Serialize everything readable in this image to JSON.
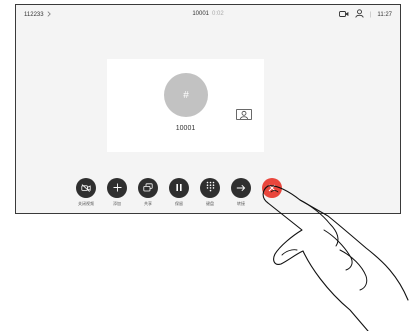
{
  "status_bar": {
    "caller": "112233",
    "callee": "10001",
    "duration": "0:02",
    "time": "11:27",
    "icons": [
      "chevron-right-icon",
      "camera-icon",
      "person-icon"
    ]
  },
  "call_card": {
    "avatar_symbol": "#",
    "callee_name": "10001",
    "selfview_icon": "selfview-icon"
  },
  "controls": [
    {
      "label": "关闭视频",
      "icon": "camera-off-icon"
    },
    {
      "label": "添加",
      "icon": "plus-icon"
    },
    {
      "label": "共享",
      "icon": "share-icon"
    },
    {
      "label": "保留",
      "icon": "pause-icon"
    },
    {
      "label": "键盘",
      "icon": "keypad-icon"
    },
    {
      "label": "转接",
      "icon": "arrow-right-icon"
    },
    {
      "label": "",
      "icon": "close-icon"
    }
  ],
  "colors": {
    "button_background": "#2f2f2f",
    "end_call": "#e9463c",
    "avatar": "#c2c2c2"
  }
}
